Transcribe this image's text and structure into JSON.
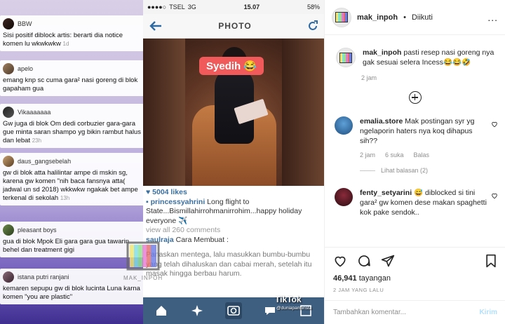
{
  "media": {
    "comments": [
      {
        "user": "BBW",
        "text": "Sisi positif diblock artis: berarti dia notice komen lu wkwkwkw",
        "time": "1d"
      },
      {
        "user": "apelo",
        "text": "emang knp sc cuma gara² nasi goreng di blok gapaham gua",
        "time": ""
      },
      {
        "user": "Vikaaaaaaa",
        "text": "Gw juga di blok Om dedi corbuzier gara-gara gue minta saran shampo yg bikin rambut halus dan lebat",
        "time": "23h"
      },
      {
        "user": "daus_gangsebelah",
        "text": "gw di blok atta halilintar ampe di mskin sg, karena gw komen \"nih baca fansnya atta( jadwal un sd 2018) wkkwkw ngakak bet ampe terkenal di sekolah",
        "time": "13h"
      },
      {
        "user": "pleasant boys",
        "text": "gua di blok Mpok Eli gara gara gua tawarin behel dan treatment gigi",
        "time": ""
      },
      {
        "user": "istana putri ranjani",
        "text": "kemaren sepupu gw di blok lucinta Luna karna komen \"you are plastic\"",
        "time": ""
      }
    ],
    "phone": {
      "carrier": "TSEL",
      "network": "3G",
      "clock": "15.07",
      "battery": "58%",
      "title": "PHOTO",
      "sticker": "Syedih 😂",
      "likes": "5004 likes",
      "poster": "princessyahrini",
      "caption": " Long flight to State...Bismillahirrohmanirrohim...happy holiday everyone ✈️",
      "view_all": "view all 260 comments",
      "commenter": "saulraja",
      "comment": " Cara Membuat :",
      "recipe": "Panaskan mentega, lalu masukkan bumbu-bumbu yang telah dihaluskan dan cabai merah, setelah itu masak hingga berbau harum."
    },
    "watermark": "MAK_INPOH",
    "tiktok": "TikTok",
    "tiktok_handle": "@duniapantiinsta"
  },
  "panel": {
    "header": {
      "username": "mak_inpoh",
      "separator": "•",
      "follow_status": "Diikuti",
      "more": "..."
    },
    "caption": {
      "username": "mak_inpoh",
      "text": " pasti resep nasi goreng nya gak sesuai selera Incess😂😂🤣",
      "time": "2 jam"
    },
    "comments": [
      {
        "username": "emalia.store",
        "text": " Mak postingan syr yg ngelaporin haters nya koq dihapus sih??",
        "time": "2 jam",
        "likes": "6 suka",
        "reply": "Balas",
        "view_replies": "Lihat balasan (2)"
      },
      {
        "username": "fenty_setyarini",
        "text": " 😅 diblocked si tini gara² gw komen dese makan spaghetti kok pake sendok..",
        "time": "",
        "likes": "",
        "reply": ""
      }
    ],
    "views_count": "46,941",
    "views_label": " tayangan",
    "posted_ago": "2 JAM YANG LALU",
    "comment_placeholder": "Tambahkan komentar...",
    "send_label": "Kirim"
  },
  "colors": {
    "accent_link": "#3a6fa0",
    "ig_send_disabled": "#b2dffc",
    "tabbar": "#3f5f80",
    "sticker": "#f15a5a"
  }
}
